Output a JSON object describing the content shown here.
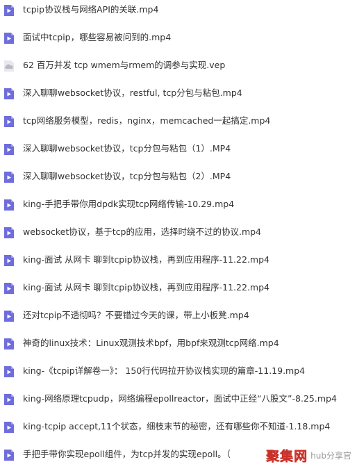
{
  "colors": {
    "video_icon_bg": "#6f6ddc",
    "video_icon_play": "#ffffff",
    "cloud_icon_bg": "#e8e8ee",
    "cloud_icon_fg": "#b9bac4",
    "text": "#333333",
    "watermark_brand": "#e8423a"
  },
  "files": [
    {
      "name": "tcpip协议栈与网络API的关联.mp4",
      "icon": "video-file-icon"
    },
    {
      "name": "面试中tcpip，哪些容易被问到的.mp4",
      "icon": "video-file-icon"
    },
    {
      "name": "62 百万并发 tcp wmem与rmem的调参与实现.vep",
      "icon": "cloud-file-icon"
    },
    {
      "name": "深入聊聊websocket协议，restful, tcp分包与粘包.mp4",
      "icon": "video-file-icon"
    },
    {
      "name": "tcp网络服务模型，redis，nginx，memcached一起搞定.mp4",
      "icon": "video-file-icon"
    },
    {
      "name": "深入聊聊websocket协议，tcp分包与粘包（1）.MP4",
      "icon": "video-file-icon"
    },
    {
      "name": "深入聊聊websocket协议，tcp分包与粘包（2）.MP4",
      "icon": "video-file-icon"
    },
    {
      "name": "king-手把手带你用dpdk实现tcp网络传输-10.29.mp4",
      "icon": "video-file-icon"
    },
    {
      "name": "websocket协议，基于tcp的应用，选择时绕不过的协议.mp4",
      "icon": "video-file-icon"
    },
    {
      "name": "king-面试 从网卡 聊到tcpip协议栈，再到应用程序-11.22.mp4",
      "icon": "video-file-icon"
    },
    {
      "name": "king-面试 从网卡 聊到tcpip协议栈，再到应用程序-11.22.mp4",
      "icon": "video-file-icon"
    },
    {
      "name": "还对tcpip不透彻吗？不要错过今天的课，带上小板凳.mp4",
      "icon": "video-file-icon"
    },
    {
      "name": "神奇的linux技术：Linux观测技术bpf，用bpf来观测tcp网络.mp4",
      "icon": "video-file-icon"
    },
    {
      "name": "king-《tcpip详解卷一》： 150行代码拉开协议栈实现的篇章-11.19.mp4",
      "icon": "video-file-icon"
    },
    {
      "name": "king-网络原理tcpudp，网络编程epollreactor，面试中正经“八股文”-8.25.mp4",
      "icon": "video-file-icon"
    },
    {
      "name": "king-tcpip accept,11个状态，细枝末节的秘密，还有哪些你不知道-1.18.mp4",
      "icon": "video-file-icon"
    },
    {
      "name": "手把手带你实现epoll组件，为tcp并发的实现epoll。（",
      "icon": "video-file-icon"
    }
  ],
  "watermark": {
    "brand": "聚集网",
    "sub": "hub分享官"
  }
}
